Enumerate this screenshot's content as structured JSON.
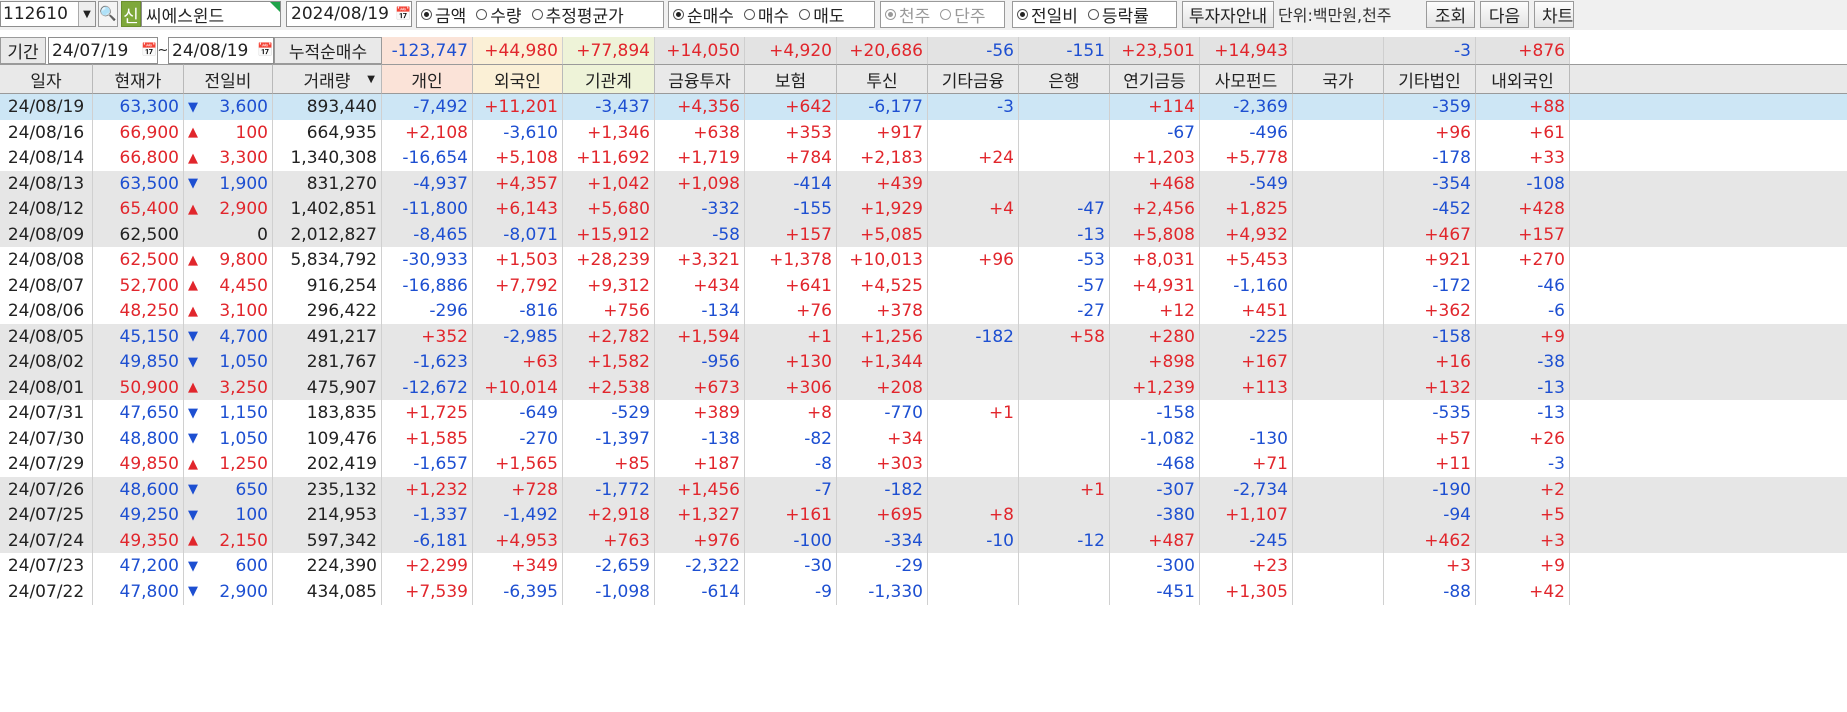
{
  "toolbar": {
    "code": "112610",
    "badge": "신",
    "name": "씨에스윈드",
    "date": "2024/08/19",
    "value_type": [
      {
        "label": "금액",
        "on": true
      },
      {
        "label": "수량",
        "on": false
      },
      {
        "label": "추정평균가",
        "on": false
      }
    ],
    "trade_type": [
      {
        "label": "순매수",
        "on": true
      },
      {
        "label": "매수",
        "on": false
      },
      {
        "label": "매도",
        "on": false
      }
    ],
    "unit_type": [
      {
        "label": "천주",
        "on": true
      },
      {
        "label": "단주",
        "on": false
      }
    ],
    "compare_type": [
      {
        "label": "전일비",
        "on": true
      },
      {
        "label": "등락률",
        "on": false
      }
    ],
    "investor_info_label": "투자자안내",
    "unit_label": "단위:백만원,천주",
    "query_label": "조회",
    "next_label": "다음",
    "chart_label": "차트"
  },
  "period": {
    "label": "기간",
    "from": "24/07/19",
    "tilde": "~",
    "to": "24/08/19",
    "cum_label": "누적순매수",
    "cum_values": [
      "-123,747",
      "+44,980",
      "+77,894",
      "+14,050",
      "+4,920",
      "+20,686",
      "-56",
      "-151",
      "+23,501",
      "+14,943",
      "",
      "-3",
      "+876"
    ]
  },
  "columns": [
    "일자",
    "현재가",
    "전일비",
    "거래량",
    "개인",
    "외국인",
    "기관계",
    "금융투자",
    "보험",
    "투신",
    "기타금융",
    "은행",
    "연기금등",
    "사모펀드",
    "국가",
    "기타법인",
    "내외국인"
  ],
  "colors": {
    "up": "#e1262c",
    "down": "#1d4fd1",
    "selected": "#cde6f5",
    "gray_row": "#e6e6e6",
    "indiv_bg": "#fbe3d8",
    "foreign_bg": "#fbf0d6",
    "inst_bg": "#eef3d8"
  },
  "rows": [
    {
      "date": "24/08/19",
      "price": "63,300",
      "dir": "down",
      "change": "3,600",
      "volume": "893,440",
      "v": [
        "-7,492",
        "+11,201",
        "-3,437",
        "+4,356",
        "+642",
        "-6,177",
        "-3",
        "",
        "+114",
        "-2,369",
        "",
        "-359",
        "+88"
      ],
      "bg": "sel"
    },
    {
      "date": "24/08/16",
      "price": "66,900",
      "dir": "up",
      "change": "100",
      "volume": "664,935",
      "v": [
        "+2,108",
        "-3,610",
        "+1,346",
        "+638",
        "+353",
        "+917",
        "",
        "",
        "-67",
        "-496",
        "",
        "+96",
        "+61"
      ],
      "bg": "white"
    },
    {
      "date": "24/08/14",
      "price": "66,800",
      "dir": "up",
      "change": "3,300",
      "volume": "1,340,308",
      "v": [
        "-16,654",
        "+5,108",
        "+11,692",
        "+1,719",
        "+784",
        "+2,183",
        "+24",
        "",
        "+1,203",
        "+5,778",
        "",
        "-178",
        "+33"
      ],
      "bg": "white"
    },
    {
      "date": "24/08/13",
      "price": "63,500",
      "dir": "down",
      "change": "1,900",
      "volume": "831,270",
      "v": [
        "-4,937",
        "+4,357",
        "+1,042",
        "+1,098",
        "-414",
        "+439",
        "",
        "",
        "+468",
        "-549",
        "",
        "-354",
        "-108"
      ],
      "bg": "gray"
    },
    {
      "date": "24/08/12",
      "price": "65,400",
      "dir": "up",
      "change": "2,900",
      "volume": "1,402,851",
      "v": [
        "-11,800",
        "+6,143",
        "+5,680",
        "-332",
        "-155",
        "+1,929",
        "+4",
        "-47",
        "+2,456",
        "+1,825",
        "",
        "-452",
        "+428"
      ],
      "bg": "gray"
    },
    {
      "date": "24/08/09",
      "price": "62,500",
      "dir": "none",
      "change": "0",
      "volume": "2,012,827",
      "v": [
        "-8,465",
        "-8,071",
        "+15,912",
        "-58",
        "+157",
        "+5,085",
        "",
        "-13",
        "+5,808",
        "+4,932",
        "",
        "+467",
        "+157"
      ],
      "bg": "gray"
    },
    {
      "date": "24/08/08",
      "price": "62,500",
      "dir": "up",
      "change": "9,800",
      "volume": "5,834,792",
      "v": [
        "-30,933",
        "+1,503",
        "+28,239",
        "+3,321",
        "+1,378",
        "+10,013",
        "+96",
        "-53",
        "+8,031",
        "+5,453",
        "",
        "+921",
        "+270"
      ],
      "bg": "white"
    },
    {
      "date": "24/08/07",
      "price": "52,700",
      "dir": "up",
      "change": "4,450",
      "volume": "916,254",
      "v": [
        "-16,886",
        "+7,792",
        "+9,312",
        "+434",
        "+641",
        "+4,525",
        "",
        "-57",
        "+4,931",
        "-1,160",
        "",
        "-172",
        "-46"
      ],
      "bg": "white"
    },
    {
      "date": "24/08/06",
      "price": "48,250",
      "dir": "up",
      "change": "3,100",
      "volume": "296,422",
      "v": [
        "-296",
        "-816",
        "+756",
        "-134",
        "+76",
        "+378",
        "",
        "-27",
        "+12",
        "+451",
        "",
        "+362",
        "-6"
      ],
      "bg": "white"
    },
    {
      "date": "24/08/05",
      "price": "45,150",
      "dir": "down",
      "change": "4,700",
      "volume": "491,217",
      "v": [
        "+352",
        "-2,985",
        "+2,782",
        "+1,594",
        "+1",
        "+1,256",
        "-182",
        "+58",
        "+280",
        "-225",
        "",
        "-158",
        "+9"
      ],
      "bg": "gray"
    },
    {
      "date": "24/08/02",
      "price": "49,850",
      "dir": "down",
      "change": "1,050",
      "volume": "281,767",
      "v": [
        "-1,623",
        "+63",
        "+1,582",
        "-956",
        "+130",
        "+1,344",
        "",
        "",
        "+898",
        "+167",
        "",
        "+16",
        "-38"
      ],
      "bg": "gray"
    },
    {
      "date": "24/08/01",
      "price": "50,900",
      "dir": "up",
      "change": "3,250",
      "volume": "475,907",
      "v": [
        "-12,672",
        "+10,014",
        "+2,538",
        "+673",
        "+306",
        "+208",
        "",
        "",
        "+1,239",
        "+113",
        "",
        "+132",
        "-13"
      ],
      "bg": "gray"
    },
    {
      "date": "24/07/31",
      "price": "47,650",
      "dir": "down",
      "change": "1,150",
      "volume": "183,835",
      "v": [
        "+1,725",
        "-649",
        "-529",
        "+389",
        "+8",
        "-770",
        "+1",
        "",
        "-158",
        "",
        "",
        "-535",
        "-13"
      ],
      "bg": "white"
    },
    {
      "date": "24/07/30",
      "price": "48,800",
      "dir": "down",
      "change": "1,050",
      "volume": "109,476",
      "v": [
        "+1,585",
        "-270",
        "-1,397",
        "-138",
        "-82",
        "+34",
        "",
        "",
        "-1,082",
        "-130",
        "",
        "+57",
        "+26"
      ],
      "bg": "white"
    },
    {
      "date": "24/07/29",
      "price": "49,850",
      "dir": "up",
      "change": "1,250",
      "volume": "202,419",
      "v": [
        "-1,657",
        "+1,565",
        "+85",
        "+187",
        "-8",
        "+303",
        "",
        "",
        "-468",
        "+71",
        "",
        "+11",
        "-3"
      ],
      "bg": "white"
    },
    {
      "date": "24/07/26",
      "price": "48,600",
      "dir": "down",
      "change": "650",
      "volume": "235,132",
      "v": [
        "+1,232",
        "+728",
        "-1,772",
        "+1,456",
        "-7",
        "-182",
        "",
        "+1",
        "-307",
        "-2,734",
        "",
        "-190",
        "+2"
      ],
      "bg": "gray"
    },
    {
      "date": "24/07/25",
      "price": "49,250",
      "dir": "down",
      "change": "100",
      "volume": "214,953",
      "v": [
        "-1,337",
        "-1,492",
        "+2,918",
        "+1,327",
        "+161",
        "+695",
        "+8",
        "",
        "-380",
        "+1,107",
        "",
        "-94",
        "+5"
      ],
      "bg": "gray"
    },
    {
      "date": "24/07/24",
      "price": "49,350",
      "dir": "up",
      "change": "2,150",
      "volume": "597,342",
      "v": [
        "-6,181",
        "+4,953",
        "+763",
        "+976",
        "-100",
        "-334",
        "-10",
        "-12",
        "+487",
        "-245",
        "",
        "+462",
        "+3"
      ],
      "bg": "gray"
    },
    {
      "date": "24/07/23",
      "price": "47,200",
      "dir": "down",
      "change": "600",
      "volume": "224,390",
      "v": [
        "+2,299",
        "+349",
        "-2,659",
        "-2,322",
        "-30",
        "-29",
        "",
        "",
        "-300",
        "+23",
        "",
        "+3",
        "+9"
      ],
      "bg": "white"
    },
    {
      "date": "24/07/22",
      "price": "47,800",
      "dir": "down",
      "change": "2,900",
      "volume": "434,085",
      "v": [
        "+7,539",
        "-6,395",
        "-1,098",
        "-614",
        "-9",
        "-1,330",
        "",
        "",
        "-451",
        "+1,305",
        "",
        "-88",
        "+42"
      ],
      "bg": "white"
    }
  ]
}
